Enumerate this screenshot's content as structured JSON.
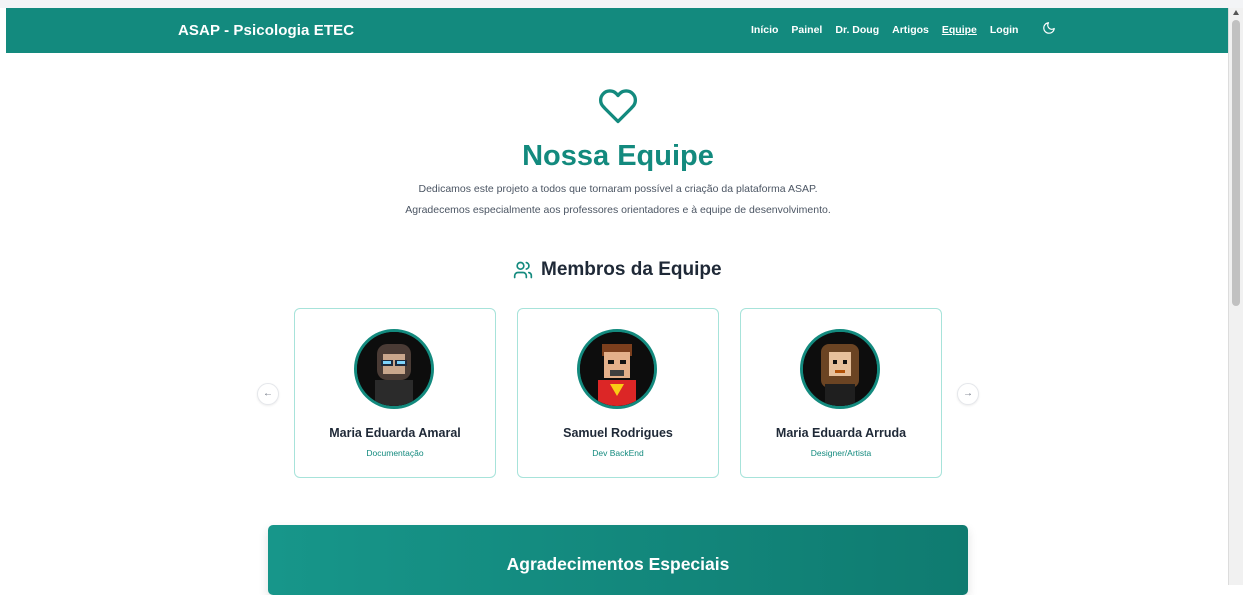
{
  "navbar": {
    "brand": "ASAP - Psicologia ETEC",
    "links": [
      "Início",
      "Painel",
      "Dr. Doug",
      "Artigos",
      "Equipe",
      "Login"
    ],
    "active_link": "Equipe",
    "theme_toggle_icon": "moon-icon"
  },
  "hero": {
    "icon": "heart-icon",
    "title": "Nossa Equipe",
    "description_line1": "Dedicamos este projeto a todos que tornaram possível a criação da plataforma ASAP.",
    "description_line2": "Agradecemos especialmente aos professores orientadores e à equipe de desenvolvimento."
  },
  "members": {
    "icon": "users-icon",
    "title": "Membros da Equipe",
    "prev_icon": "arrow-left-icon",
    "next_icon": "arrow-right-icon",
    "cards": [
      {
        "name": "Maria Eduarda Amaral",
        "role": "Documentação"
      },
      {
        "name": "Samuel Rodrigues",
        "role": "Dev BackEnd"
      },
      {
        "name": "Maria Eduarda Arruda",
        "role": "Designer/Artista"
      }
    ]
  },
  "special_thanks": {
    "title": "Agradecimentos Especiais"
  },
  "colors": {
    "primary": "#138a7e",
    "text_dark": "#1f2937",
    "text_muted": "#4b5563",
    "card_border": "#a7e3da"
  }
}
